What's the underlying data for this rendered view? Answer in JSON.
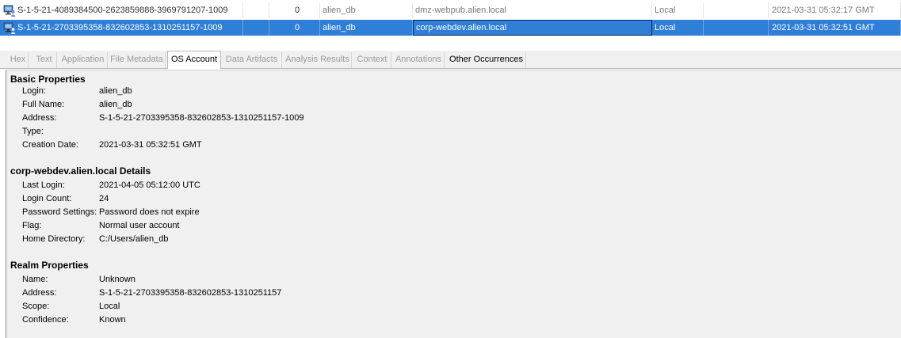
{
  "results": {
    "rows": [
      {
        "sid": "S-1-5-21-4089384500-2623859888-3969791207-1009",
        "count": "0",
        "user": "alien_db",
        "host": "dmz-webpub.alien.local",
        "scope": "Local",
        "date": "2021-03-31 05:32:17 GMT"
      },
      {
        "sid": "S-1-5-21-2703395358-832602853-1310251157-1009",
        "count": "0",
        "user": "alien_db",
        "host": "corp-webdev.alien.local",
        "scope": "Local",
        "date": "2021-03-31 05:32:51 GMT"
      }
    ]
  },
  "tabs": [
    {
      "label": "Hex"
    },
    {
      "label": "Text"
    },
    {
      "label": "Application"
    },
    {
      "label": "File Metadata"
    },
    {
      "label": "OS Account"
    },
    {
      "label": "Data Artifacts"
    },
    {
      "label": "Analysis Results"
    },
    {
      "label": "Context"
    },
    {
      "label": "Annotations"
    },
    {
      "label": "Other Occurrences"
    }
  ],
  "basic": {
    "title": "Basic Properties",
    "fields": [
      {
        "label": "Login:",
        "value": "alien_db"
      },
      {
        "label": "Full Name:",
        "value": "alien_db"
      },
      {
        "label": "Address:",
        "value": "S-1-5-21-2703395358-832602853-1310251157-1009"
      },
      {
        "label": "Type:",
        "value": ""
      },
      {
        "label": "Creation Date:",
        "value": "2021-03-31 05:32:51 GMT"
      }
    ]
  },
  "host_details": {
    "title": "corp-webdev.alien.local Details",
    "fields": [
      {
        "label": "Last Login:",
        "value": "2021-04-05 05:12:00 UTC"
      },
      {
        "label": "Login Count:",
        "value": "24"
      },
      {
        "label": "Password Settings:",
        "value": "Password does not expire"
      },
      {
        "label": "Flag:",
        "value": "Normal user account"
      },
      {
        "label": "Home Directory:",
        "value": "C:/Users/alien_db"
      }
    ]
  },
  "realm": {
    "title": "Realm Properties",
    "fields": [
      {
        "label": "Name:",
        "value": "Unknown"
      },
      {
        "label": "Address:",
        "value": "S-1-5-21-2703395358-832602853-1310251157"
      },
      {
        "label": "Scope:",
        "value": "Local"
      },
      {
        "label": "Confidence:",
        "value": "Known"
      }
    ]
  },
  "icons": {
    "account": "user-account-icon"
  },
  "colors": {
    "selection": "#2f7fd8",
    "panel": "#f0f0f0"
  }
}
